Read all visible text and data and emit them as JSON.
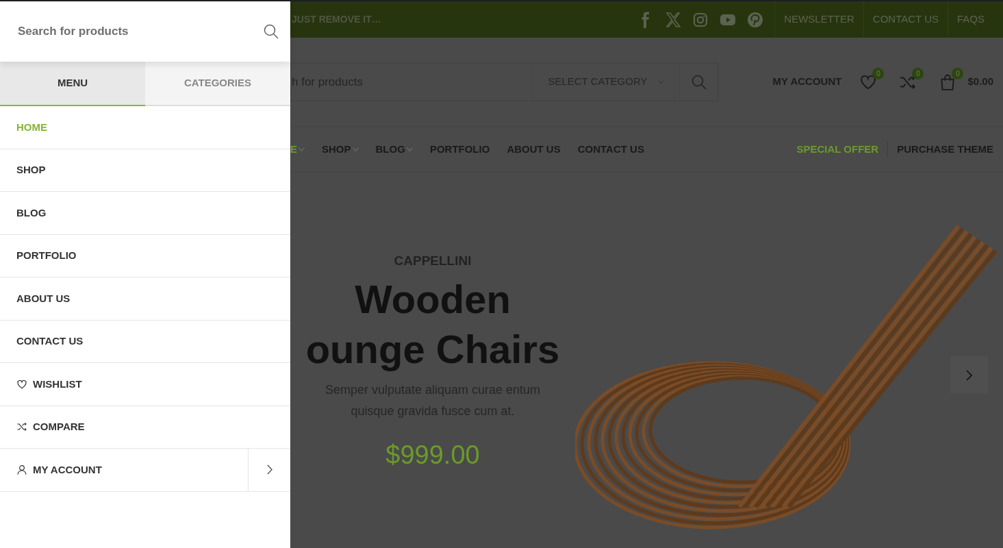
{
  "drawer": {
    "search": {
      "placeholder": "Search for products"
    },
    "tabs": [
      {
        "label": "MENU",
        "selected": true
      },
      {
        "label": "CATEGORIES",
        "selected": false
      }
    ],
    "items": [
      {
        "label": "HOME",
        "selected": true,
        "kind": "page",
        "submenu": false
      },
      {
        "label": "SHOP",
        "selected": false,
        "kind": "page",
        "submenu": false
      },
      {
        "label": "BLOG",
        "selected": false,
        "kind": "page",
        "submenu": false
      },
      {
        "label": "PORTFOLIO",
        "selected": false,
        "kind": "page",
        "submenu": false
      },
      {
        "label": "ABOUT US",
        "selected": false,
        "kind": "page",
        "submenu": false
      },
      {
        "label": "CONTACT US",
        "selected": false,
        "kind": "page",
        "submenu": false
      },
      {
        "label": "WISHLIST",
        "selected": false,
        "kind": "wishlist",
        "submenu": false
      },
      {
        "label": "COMPARE",
        "selected": false,
        "kind": "compare",
        "submenu": false
      },
      {
        "label": "MY ACCOUNT",
        "selected": false,
        "kind": "account",
        "submenu": true
      }
    ]
  },
  "topbar": {
    "promo": "JUST REMOVE IT…",
    "links": [
      "NEWSLETTER",
      "CONTACT US",
      "FAQS"
    ]
  },
  "header": {
    "search": {
      "placeholder": "h for products"
    },
    "category": "SELECT CATEGORY",
    "account": "MY ACCOUNT",
    "wishlist_count": "0",
    "compare_count": "0",
    "cart_count": "0",
    "cart_total": "$0.00"
  },
  "nav": {
    "items": [
      {
        "label": "E",
        "dropdown": true,
        "selected": true
      },
      {
        "label": "SHOP",
        "dropdown": true,
        "selected": false
      },
      {
        "label": "BLOG",
        "dropdown": true,
        "selected": false
      },
      {
        "label": "PORTFOLIO",
        "dropdown": false,
        "selected": false
      },
      {
        "label": "ABOUT US",
        "dropdown": false,
        "selected": false
      },
      {
        "label": "CONTACT US",
        "dropdown": false,
        "selected": false
      }
    ],
    "special": "SPECIAL OFFER",
    "purchase": "PURCHASE THEME"
  },
  "hero": {
    "brand": "CAPPELLINI",
    "title_lines": [
      "Wooden",
      "ounge Chairs"
    ],
    "text": "Semper vulputate aliquam curae entum quisque gravida fusce cum at.",
    "price": "$999.00"
  }
}
